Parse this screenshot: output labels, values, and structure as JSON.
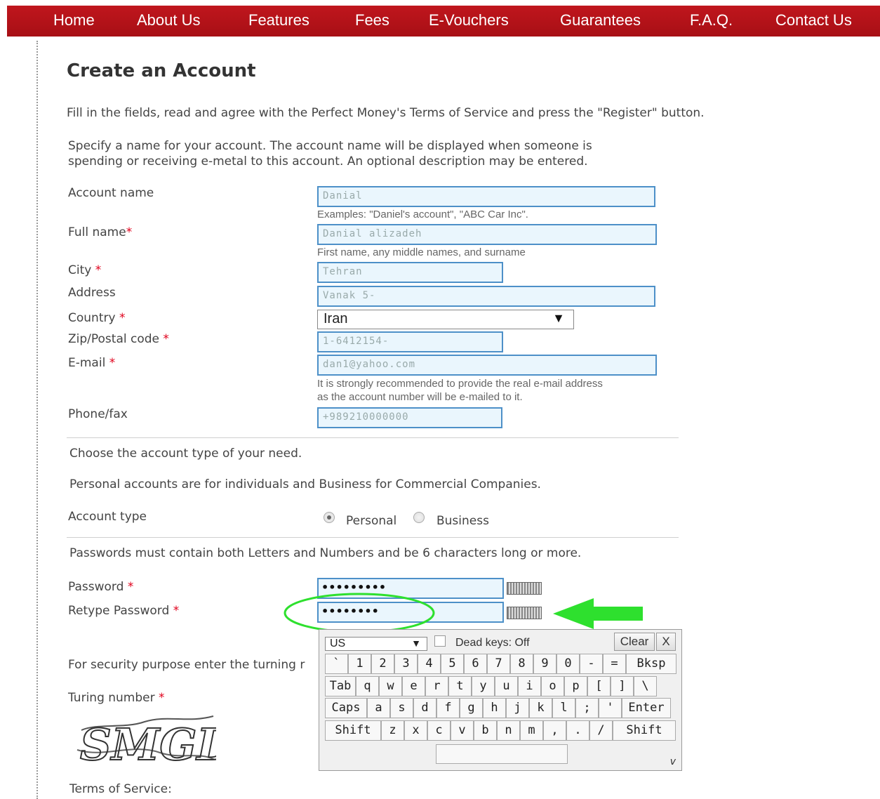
{
  "nav": {
    "items": [
      "Home",
      "About Us",
      "Features",
      "Fees",
      "E-Vouchers",
      "Guarantees",
      "F.A.Q.",
      "Contact Us"
    ]
  },
  "page": {
    "title": "Create an Account",
    "intro": "Fill in the fields, read and agree with the Perfect Money's Terms of Service and press the \"Register\" button.",
    "account_desc_1": "Specify a name for your account. The account name will be displayed when someone is",
    "account_desc_2": "spending or receiving e-metal to this account. An optional description may be entered."
  },
  "form": {
    "account_name": {
      "label": "Account name",
      "value": "Danial",
      "hint": "Examples: \"Daniel's account\", \"ABC Car Inc\"."
    },
    "full_name": {
      "label": "Full name",
      "value": "Danial alizadeh",
      "hint": "First name, any middle names, and surname"
    },
    "city": {
      "label": "City",
      "value": "Tehran"
    },
    "address": {
      "label": "Address",
      "value": "Vanak 5-"
    },
    "country": {
      "label": "Country",
      "value": "Iran"
    },
    "zip": {
      "label": "Zip/Postal code",
      "value": "1-6412154-"
    },
    "email": {
      "label": "E-mail",
      "value": "dan1@yahoo.com",
      "hint_1": "It is strongly recommended to provide the real e-mail address",
      "hint_2": "as the account number will be e-mailed to it."
    },
    "phone": {
      "label": "Phone/fax",
      "value": "+989210000000"
    },
    "required_mark": "*"
  },
  "account_type": {
    "choose_text": "Choose the account type of your need.",
    "desc": "Personal accounts are for individuals and Business for Commercial Companies.",
    "label": "Account type",
    "personal": "Personal",
    "business": "Business",
    "selected": "Personal"
  },
  "password": {
    "rules": "Passwords must contain both Letters and Numbers and be 6 characters long or more.",
    "label": "Password",
    "retype_label": "Retype Password",
    "value": "•••••••••",
    "retype_value": "••••••••"
  },
  "security": {
    "text": "For security purpose enter the turning r",
    "turing_label": "Turing number",
    "captcha_text": "SMGD",
    "terms": "Terms of Service:"
  },
  "keyboard": {
    "layout": "US",
    "dead_keys": "Dead keys: Off",
    "clear": "Clear",
    "close": "X",
    "row1": [
      "`",
      "1",
      "2",
      "3",
      "4",
      "5",
      "6",
      "7",
      "8",
      "9",
      "0",
      "-",
      "=",
      "Bksp"
    ],
    "row2": [
      "Tab",
      "q",
      "w",
      "e",
      "r",
      "t",
      "y",
      "u",
      "i",
      "o",
      "p",
      "[",
      "]",
      "\\"
    ],
    "row3": [
      "Caps",
      "a",
      "s",
      "d",
      "f",
      "g",
      "h",
      "j",
      "k",
      "l",
      ";",
      "'",
      "Enter"
    ],
    "row4": [
      "Shift",
      "z",
      "x",
      "c",
      "v",
      "b",
      "n",
      "m",
      ",",
      ".",
      "/",
      "Shift"
    ],
    "version": "v"
  },
  "colors": {
    "nav_bg": "#b3131a",
    "input_bg": "#eaf6fd",
    "input_border": "#4d90c8",
    "required": "#e0001b",
    "annotation": "#2ee02e"
  }
}
